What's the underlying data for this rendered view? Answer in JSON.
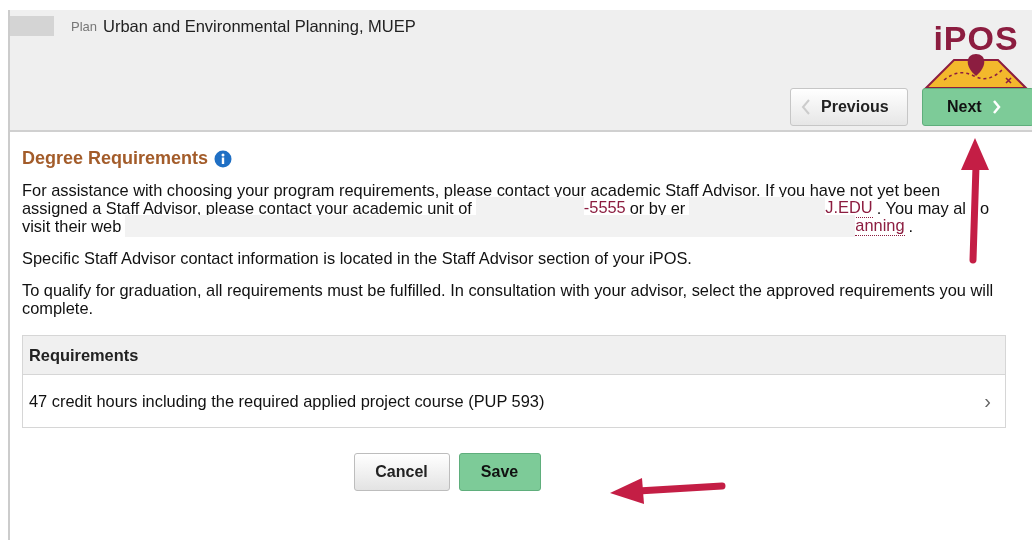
{
  "header": {
    "plan_label": "Plan",
    "plan_name": "Urban and Environmental Planning, MUEP",
    "logo": {
      "text": "iPOS"
    },
    "nav_buttons": [
      {
        "label": "Previous",
        "kind": "prev"
      },
      {
        "label": "Next",
        "kind": "next"
      }
    ]
  },
  "section": {
    "title": "Degree Requirements",
    "paragraph_lines": [
      [
        {
          "kind": "text",
          "text": "For assistance with choosing your program requirements, please contact your academic Staff Advisor. If you have not yet been"
        }
      ],
      [
        {
          "kind": "text",
          "text": "assigned a Staff Advisor, please contact your academic unit of"
        },
        {
          "kind": "redacted"
        },
        {
          "kind": "link",
          "text": "-5555"
        },
        {
          "kind": "text",
          "text": "or by er"
        },
        {
          "kind": "redacted"
        },
        {
          "kind": "link",
          "text": "J.EDU"
        },
        {
          "kind": "text",
          "text": ". You may al"
        },
        {
          "kind": "covered"
        },
        {
          "kind": "text",
          "text": "o"
        }
      ],
      [
        {
          "kind": "text",
          "text": "visit their web"
        },
        {
          "kind": "redacted"
        },
        {
          "kind": "link",
          "text": "anning"
        },
        {
          "kind": "text",
          "text": "."
        }
      ]
    ],
    "paragraphs": [
      "Specific Staff Advisor contact information is located in the Staff Advisor section of your iPOS.",
      "To qualify for graduation, all requirements must be fulfilled. In consultation with your advisor, select the approved requirements you will complete."
    ]
  },
  "table": {
    "header": "Requirements",
    "rows": [
      {
        "text": "47 credit hours including the required applied project course (PUP 593)",
        "chevron": "›"
      }
    ]
  },
  "buttons": [
    {
      "label": "Cancel",
      "kind": "plain"
    },
    {
      "label": "Save",
      "kind": "primary"
    }
  ]
}
